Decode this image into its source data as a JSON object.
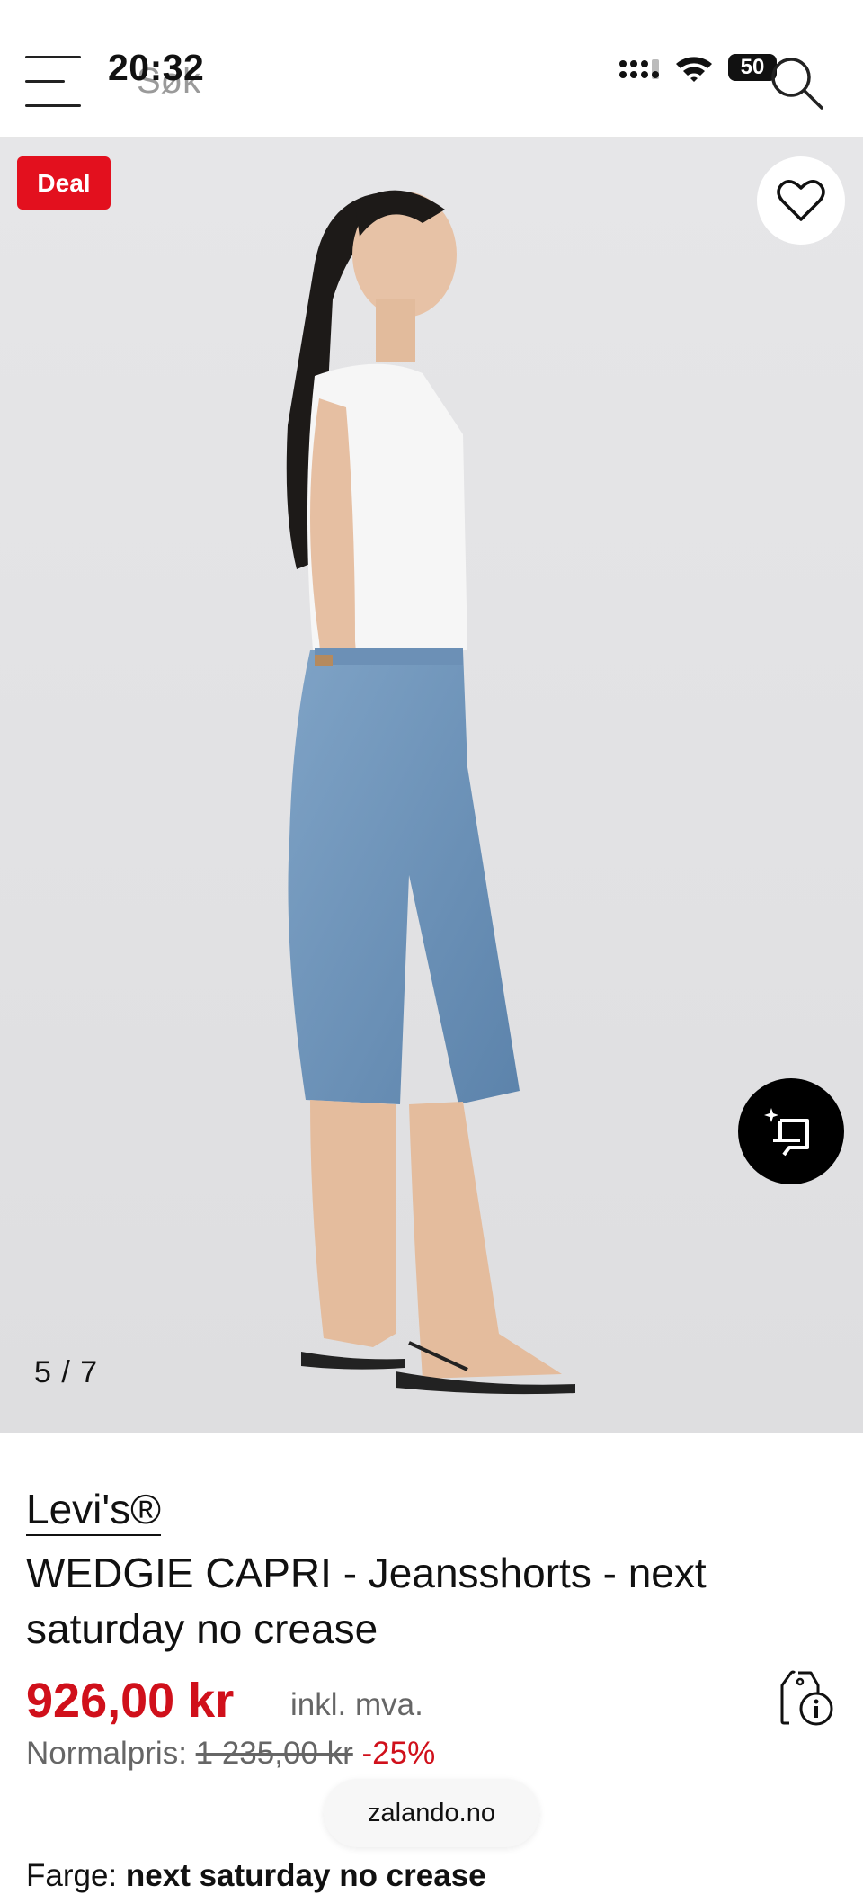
{
  "header": {
    "search_placeholder": "Søk",
    "clock": "20:32",
    "battery": "50",
    "icons": {
      "menu": "hamburger-menu-icon",
      "search": "search-icon",
      "signal": "cellular-signal-icon",
      "wifi": "wifi-icon"
    }
  },
  "gallery": {
    "deal_badge": "Deal",
    "counter": "5 / 7",
    "current_image": 5,
    "total_images": 7,
    "icons": {
      "wishlist": "heart-icon",
      "ai": "ai-crop-icon"
    }
  },
  "product": {
    "brand": "Levi's®",
    "title": "WEDGIE CAPRI - Jeansshorts - next saturday no crease",
    "price": "926,00 kr",
    "vat_label": "inkl. mva.",
    "normal_price_label": "Normalpris:",
    "normal_price": "1 235,00 kr",
    "discount": "-25%",
    "color_label": "Farge:",
    "color_value": "next saturday no crease",
    "icons": {
      "price_info": "price-tag-info-icon"
    }
  },
  "site": {
    "domain": "zalando.no"
  },
  "colors": {
    "accent": "#d0101b",
    "deal": "#e3101e"
  }
}
